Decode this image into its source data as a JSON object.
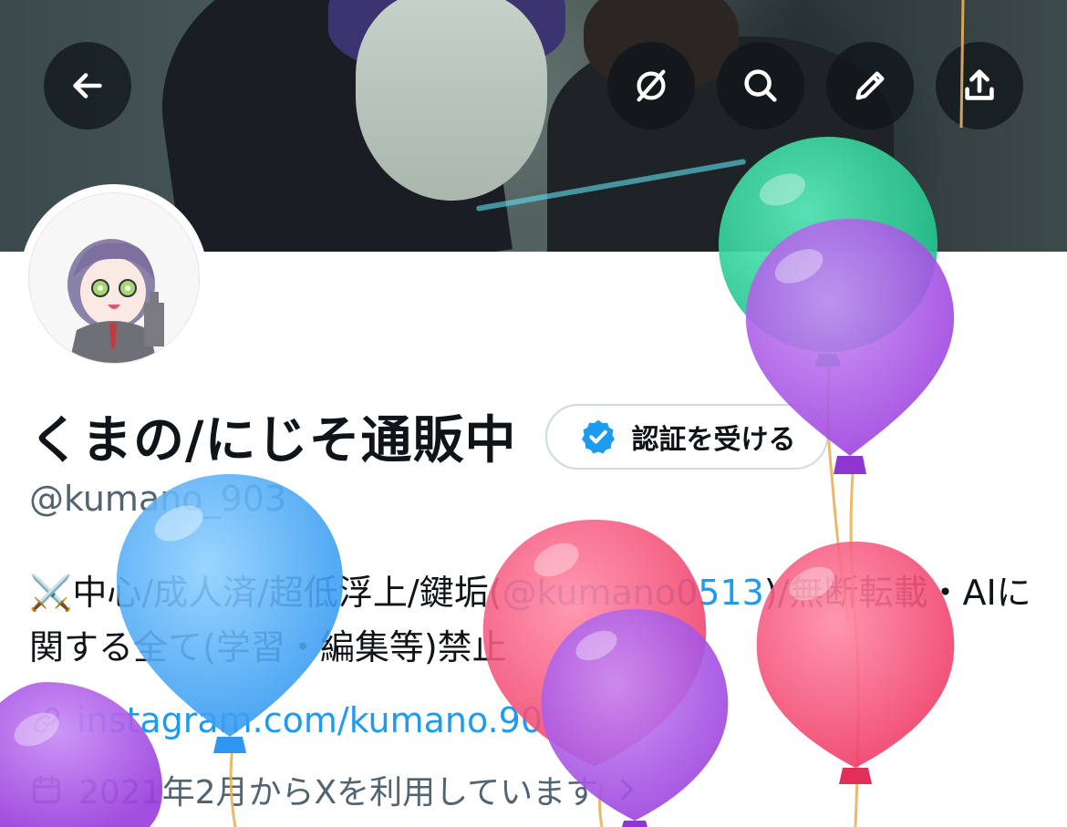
{
  "header": {
    "back_icon": "arrow-left-icon",
    "actions": [
      {
        "name": "lens-off-icon"
      },
      {
        "name": "search-icon"
      },
      {
        "name": "pencil-icon"
      },
      {
        "name": "share-icon"
      }
    ]
  },
  "profile": {
    "display_name": "くまの/にじそ通販中",
    "verify_button_label": "認証を受ける",
    "handle": "@kumano_903",
    "bio_prefix": "⚔️中心/成人済/超低浮上/鍵垢(",
    "bio_mention": "@kumano0513",
    "bio_suffix": ")/無断転載・AIに関する全て(学習・編集等)禁止",
    "link_text": "instagram.com/kumano.903?...",
    "joined_text": "2021年2月からXを利用しています"
  },
  "colors": {
    "accent": "#1d9bf0",
    "secondary_text": "#536471",
    "balloon_green": "#2fd39a",
    "balloon_purple": "#a24fe0",
    "balloon_blue": "#4aa8f5",
    "balloon_red": "#f0426a"
  }
}
